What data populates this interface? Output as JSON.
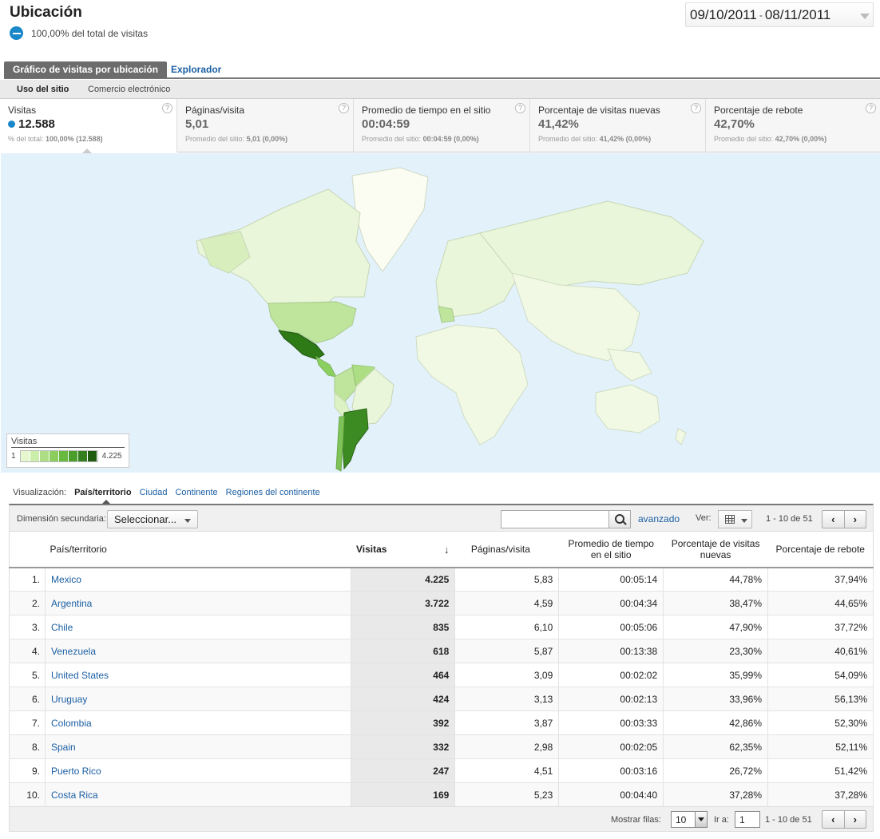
{
  "header": {
    "title": "Ubicación",
    "subtitle": "100,00% del total de visitas",
    "date_start": "09/10/2011",
    "date_sep": "-",
    "date_end": "08/11/2011"
  },
  "tabs": [
    {
      "label": "Gráfico de visitas por ubicación",
      "active": true
    },
    {
      "label": "Explorador",
      "active": false
    }
  ],
  "subtabs": [
    {
      "label": "Uso del sitio",
      "active": true
    },
    {
      "label": "Comercio electrónico",
      "active": false
    }
  ],
  "metrics": [
    {
      "label": "Visitas",
      "value": "12.588",
      "sub_prefix": "% del total:",
      "sub_value": "100,00% (12.588)"
    },
    {
      "label": "Páginas/visita",
      "value": "5,01",
      "sub_prefix": "Promedio del sitio:",
      "sub_value": "5,01 (0,00%)"
    },
    {
      "label": "Promedio de tiempo en el sitio",
      "value": "00:04:59",
      "sub_prefix": "Promedio del sitio:",
      "sub_value": "00:04:59 (0,00%)"
    },
    {
      "label": "Porcentaje de visitas nuevas",
      "value": "41,42%",
      "sub_prefix": "Promedio del sitio:",
      "sub_value": "41,42% (0,00%)"
    },
    {
      "label": "Porcentaje de rebote",
      "value": "42,70%",
      "sub_prefix": "Promedio del sitio:",
      "sub_value": "42,70% (0,00%)"
    }
  ],
  "help_glyph": "?",
  "map_legend": {
    "title": "Visitas",
    "min": "1",
    "max": "4.225",
    "colors": [
      "#e6f6cf",
      "#cbeeaa",
      "#aede84",
      "#8bce5e",
      "#69b941",
      "#4b9d2c",
      "#347f1d",
      "#1f5c10"
    ]
  },
  "visualization": {
    "label": "Visualización:",
    "options": [
      {
        "label": "País/territorio",
        "active": true
      },
      {
        "label": "Ciudad",
        "active": false
      },
      {
        "label": "Continente",
        "active": false
      },
      {
        "label": "Regiones del continente",
        "active": false
      }
    ]
  },
  "toolbar": {
    "secondary_label": "Dimensión secundaria:",
    "secondary_value": "Seleccionar...",
    "search_value": "",
    "advanced_label": "avanzado",
    "view_label": "Ver:",
    "range": "1 - 10 de 51",
    "prev": "‹",
    "next": "›"
  },
  "table": {
    "columns": [
      "País/territorio",
      "Visitas",
      "Páginas/visita",
      "Promedio de tiempo en el sitio",
      "Porcentaje de visitas nuevas",
      "Porcentaje de rebote"
    ],
    "sort_glyph": "↓",
    "rows": [
      {
        "idx": "1.",
        "country": "Mexico",
        "visits": "4.225",
        "pages": "5,83",
        "time": "00:05:14",
        "new": "44,78%",
        "bounce": "37,94%"
      },
      {
        "idx": "2.",
        "country": "Argentina",
        "visits": "3.722",
        "pages": "4,59",
        "time": "00:04:34",
        "new": "38,47%",
        "bounce": "44,65%"
      },
      {
        "idx": "3.",
        "country": "Chile",
        "visits": "835",
        "pages": "6,10",
        "time": "00:05:06",
        "new": "47,90%",
        "bounce": "37,72%"
      },
      {
        "idx": "4.",
        "country": "Venezuela",
        "visits": "618",
        "pages": "5,87",
        "time": "00:13:38",
        "new": "23,30%",
        "bounce": "40,61%"
      },
      {
        "idx": "5.",
        "country": "United States",
        "visits": "464",
        "pages": "3,09",
        "time": "00:02:02",
        "new": "35,99%",
        "bounce": "54,09%"
      },
      {
        "idx": "6.",
        "country": "Uruguay",
        "visits": "424",
        "pages": "3,13",
        "time": "00:02:13",
        "new": "33,96%",
        "bounce": "56,13%"
      },
      {
        "idx": "7.",
        "country": "Colombia",
        "visits": "392",
        "pages": "3,87",
        "time": "00:03:33",
        "new": "42,86%",
        "bounce": "52,30%"
      },
      {
        "idx": "8.",
        "country": "Spain",
        "visits": "332",
        "pages": "2,98",
        "time": "00:02:05",
        "new": "62,35%",
        "bounce": "52,11%"
      },
      {
        "idx": "9.",
        "country": "Puerto Rico",
        "visits": "247",
        "pages": "4,51",
        "time": "00:03:16",
        "new": "26,72%",
        "bounce": "51,42%"
      },
      {
        "idx": "10.",
        "country": "Costa Rica",
        "visits": "169",
        "pages": "5,23",
        "time": "00:04:40",
        "new": "37,28%",
        "bounce": "37,28%"
      }
    ]
  },
  "footer": {
    "rows_label": "Mostrar filas:",
    "rows_value": "10",
    "goto_label": "Ir a:",
    "goto_value": "1",
    "range": "1 - 10 de 51"
  }
}
